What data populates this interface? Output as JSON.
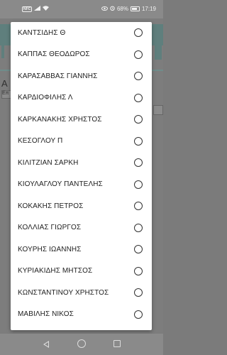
{
  "status_bar": {
    "nfc_label": "NFC",
    "battery_percent": "68%",
    "time": "17:19"
  },
  "options": [
    {
      "label": "ΚΑΝΤΣΙΔΗΣ Θ",
      "selected": false
    },
    {
      "label": "ΚΑΠΠΑΣ ΘΕΟΔΩΡΟΣ",
      "selected": false
    },
    {
      "label": "ΚΑΡΑΣΑΒΒΑΣ ΓΙΑΝΝΗΣ",
      "selected": false
    },
    {
      "label": "ΚΑΡΔΙΟΦΙΛΗΣ Λ",
      "selected": false
    },
    {
      "label": "ΚΑΡΚΑΝΑΚΗΣ ΧΡΗΣΤΟΣ",
      "selected": false
    },
    {
      "label": "ΚΕΣΟΓΛΟΥ Π",
      "selected": false
    },
    {
      "label": "ΚΙΛΙΤΖΙΑΝ ΣΑΡΚΗ",
      "selected": false
    },
    {
      "label": "ΚΙΟΥΛΑΓΛΟΥ ΠΑΝΤΕΛΗΣ",
      "selected": false
    },
    {
      "label": "ΚΟΚΑΚΗΣ ΠΕΤΡΟΣ",
      "selected": false
    },
    {
      "label": "ΚΟΛΛΙΑΣ ΓΙΩΡΓΟΣ",
      "selected": false
    },
    {
      "label": "ΚΟΥΡΗΣ ΙΩΑΝΝΗΣ",
      "selected": false
    },
    {
      "label": "ΚΥΡΙΑΚΙΔΗΣ ΜΗΤΣΟΣ",
      "selected": false
    },
    {
      "label": "ΚΩΝΣΤΑΝΤΙΝΟΥ ΧΡΗΣΤΟΣ",
      "selected": false
    },
    {
      "label": "ΜΑΒΙΛΗΣ ΝΙΚΟΣ",
      "selected": false
    }
  ],
  "background": {
    "label_fragment": "Α",
    "select_fragment": "Επ"
  },
  "colors": {
    "dialog_bg": "#ffffff",
    "scrim": "#7b7b7b",
    "header_teal_dimmed": "#5f7f7d"
  }
}
